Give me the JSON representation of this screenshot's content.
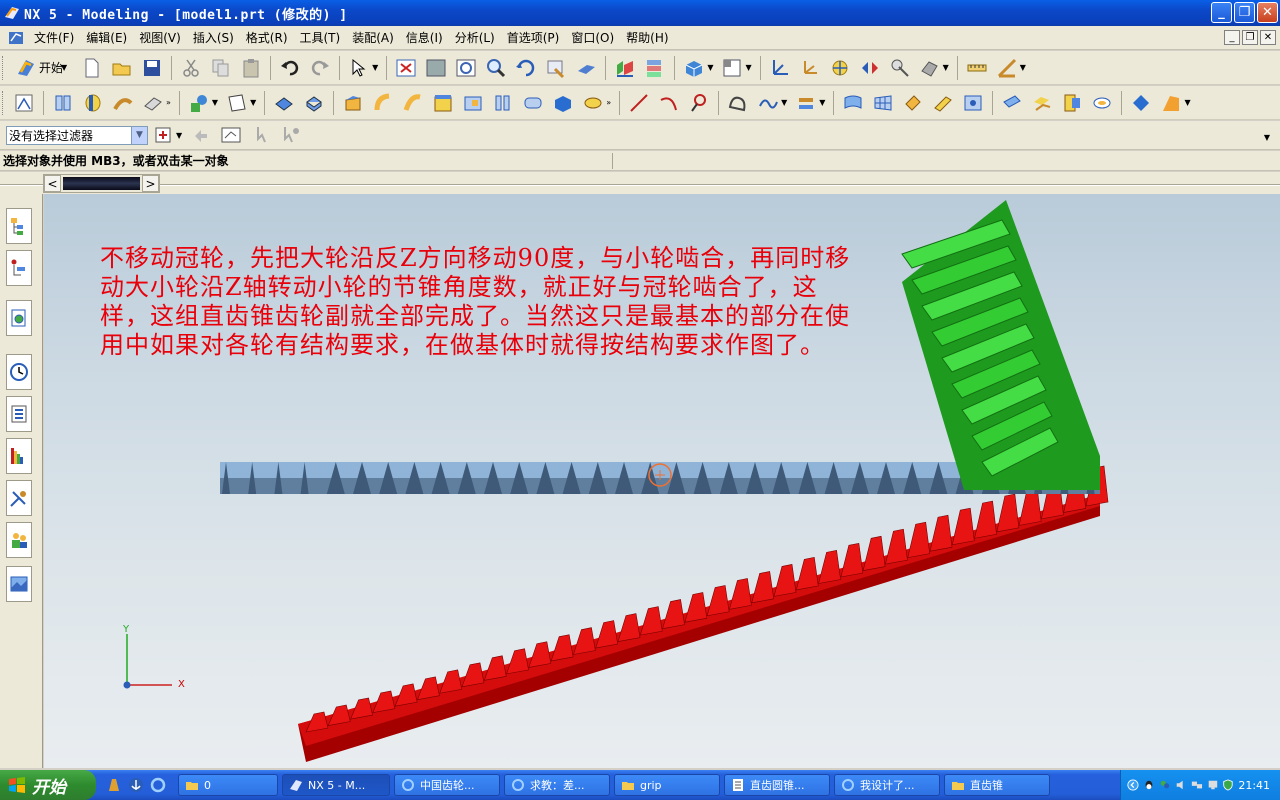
{
  "window": {
    "title": "NX 5 - Modeling - [model1.prt  (修改的) ]"
  },
  "menu": {
    "items": [
      "文件(F)",
      "编辑(E)",
      "视图(V)",
      "插入(S)",
      "格式(R)",
      "工具(T)",
      "装配(A)",
      "信息(I)",
      "分析(L)",
      "首选项(P)",
      "窗口(O)",
      "帮助(H)"
    ]
  },
  "toolbar": {
    "start_label": "开始"
  },
  "filter": {
    "value": "没有选择过滤器"
  },
  "prompt": {
    "text": "选择对象并使用 MB3，或者双击某一对象"
  },
  "viewport": {
    "annotation": "不移动冠轮，先把大轮沿反Z方向移动90度，与小轮啮合，再同时移动大小轮沿Z轴转动小轮的节锥角度数，就正好与冠轮啮合了，这样，这组直齿锥齿轮副就全部完成了。当然这只是最基本的部分在使用中如果对各轮有结构要求，在做基体时就得按结构要求作图了。",
    "axis_x": "X",
    "axis_y": "Y",
    "colors": {
      "green_gear": "#2ec42e",
      "blue_gear": "#8fb4d8",
      "red_gear": "#e01010"
    }
  },
  "taskbar": {
    "start_label": "开始",
    "tasks": [
      "0",
      "NX 5 - M...",
      "中国齿轮...",
      "求教：差...",
      "grip",
      "直齿圆锥...",
      "我设计了...",
      "直齿锥"
    ],
    "clock": "21:41"
  }
}
